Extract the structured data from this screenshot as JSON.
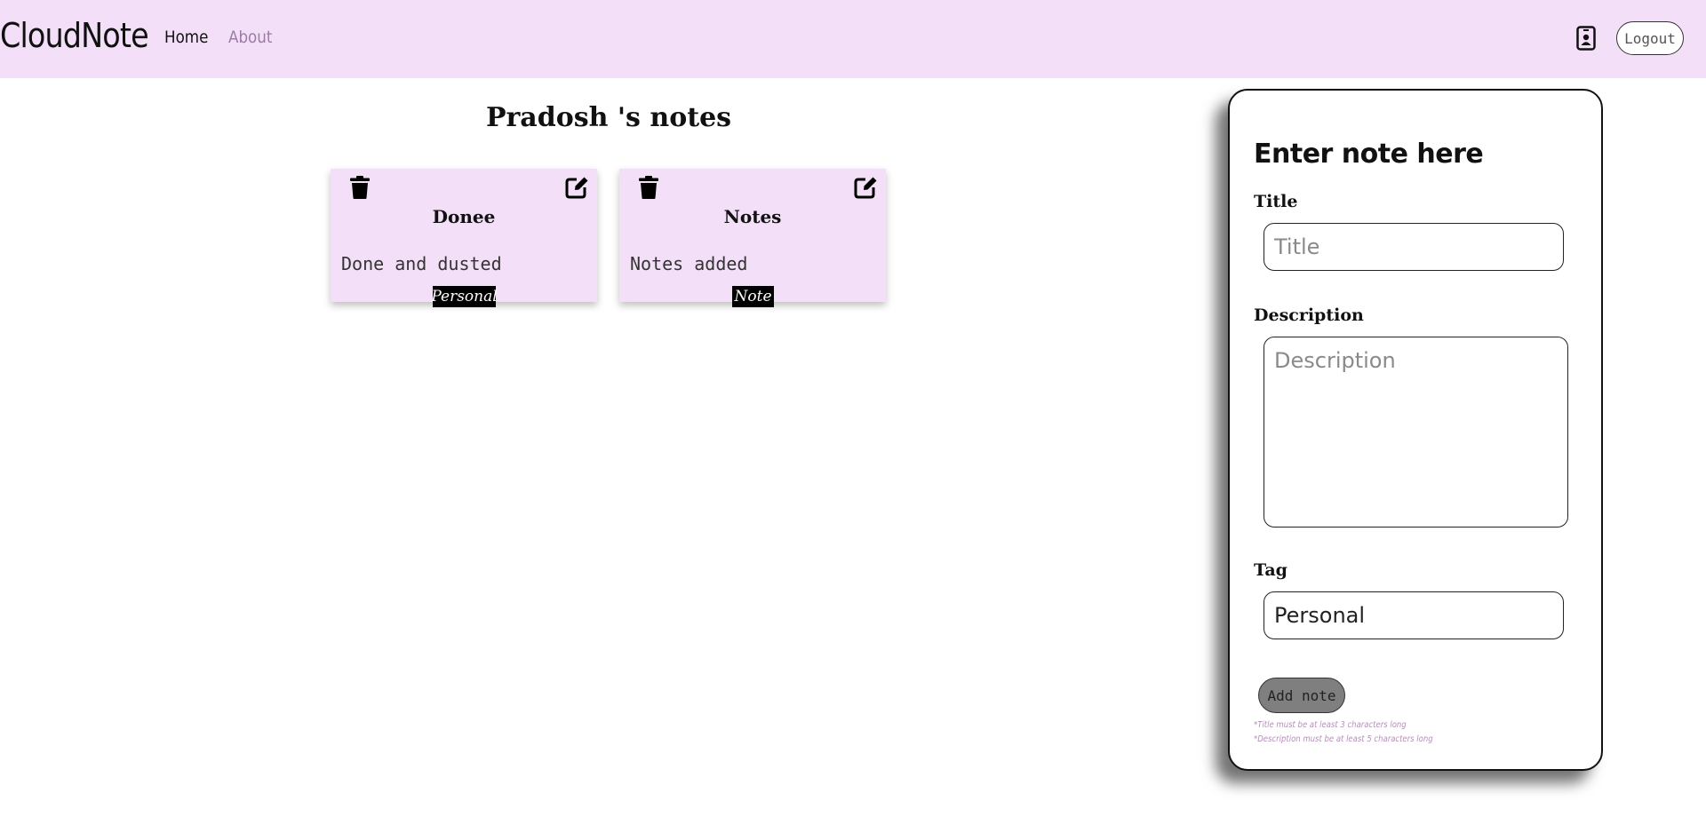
{
  "navbar": {
    "brand": "CloudNote",
    "links": [
      {
        "label": "Home",
        "active": true
      },
      {
        "label": "About",
        "active": false
      }
    ],
    "contact_icon": "contact-card-icon",
    "logout_label": "Logout",
    "colors": {
      "background": "#f3e0f8",
      "inactive_link": "#9b7aa6"
    }
  },
  "notes": {
    "heading": "Pradosh 's notes",
    "cards": [
      {
        "title": "Donee",
        "description": "Done and dusted",
        "tag": "Personal",
        "delete_icon": "trash-icon",
        "edit_icon": "edit-icon"
      },
      {
        "title": "Notes",
        "description": "Notes added",
        "tag": "Note",
        "delete_icon": "trash-icon",
        "edit_icon": "edit-icon"
      }
    ],
    "card_color": "#f3e0f8"
  },
  "form": {
    "heading": "Enter note here",
    "title_label": "Title",
    "title_placeholder": "Title",
    "title_value": "",
    "description_label": "Description",
    "description_placeholder": "Description",
    "description_value": "",
    "tag_label": "Tag",
    "tag_value": "Personal",
    "submit_label": "Add note",
    "hints": [
      "*Title must be at least 3 characters long",
      "*Description must be at least 5 characters long"
    ],
    "hint_color": "#b48fb8"
  }
}
